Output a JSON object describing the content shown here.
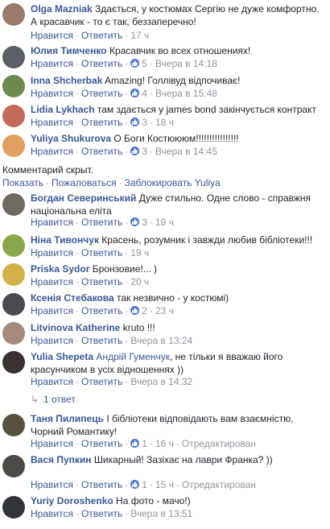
{
  "labels": {
    "like": "Нравится",
    "reply": "Ответить",
    "dot": "·",
    "edited": "Отредактирован"
  },
  "comments": [
    {
      "author": "Olga Mazniak",
      "text": "Здається, у костюмах Сергію не дуже комфортно. А красавчик - то є так, беззаперечно!",
      "likes": "",
      "time": "17 ч",
      "avatar_color": "#9a7b6a"
    },
    {
      "author": "Юлия Тимченко",
      "text": "Красавчик во всех отношениях!",
      "likes": "5",
      "time": "Вчера в 14:18",
      "avatar_color": "#5b5f66"
    },
    {
      "author": "Inna Shcherbak",
      "text": "Amazing! Голлівуд відпочиває!",
      "likes": "4",
      "time": "Вчера в 15:48",
      "avatar_color": "#6b8a4e"
    },
    {
      "author": "Lidia Lykhach",
      "text": "там здається у james bond закінчується контракт",
      "likes": "3",
      "time": "18 ч",
      "avatar_color": "#c46a5a"
    },
    {
      "author": "Yuliya Shukurova",
      "text": "О Боги Костюююм!!!!!!!!!!!!!!!!",
      "likes": "3",
      "time": "Вчера в 14:45",
      "avatar_color": "#e0a060"
    },
    {
      "author": "Богдан Северинський",
      "text": "Дуже стильно. Одне слово - справжня національна еліта",
      "likes": "3",
      "time": "19 ч",
      "avatar_color": "#6e6a60"
    },
    {
      "author": "Ніна Тивончук",
      "text": "Красень, розумник і завжди любив бібліотеки!!!",
      "likes": "",
      "time": "19 ч",
      "avatar_color": "#8aa64a"
    },
    {
      "author": "Priska Sydor",
      "text": "Бронзовие!... )",
      "likes": "",
      "time": "20 ч",
      "avatar_color": "#d4b048"
    },
    {
      "author": "Ксенія Стебакова",
      "text": "так незвично - у костюмі)",
      "likes": "2",
      "time": "23 ч",
      "avatar_color": "#4a4a50"
    },
    {
      "author": "Litvinova Katherine",
      "text": "kruto !!!",
      "likes": "",
      "time": "Вчера в 13:24",
      "avatar_color": "#a58a7a"
    },
    {
      "author": "Yulia Shepeta",
      "mention": "Андрій Гуменчук",
      "text": ", не тільки я вважаю його красунчиком в усіх відношеннях ))",
      "likes": "",
      "time": "Вчера в 14:32",
      "avatar_color": "#3a3030"
    },
    {
      "author": "Таня Пилипець",
      "text": "І бібліотеки відповідають вам взаємністю, Чорний Романтику!",
      "likes": "1",
      "time": "16 ч",
      "edited": true,
      "avatar_color": "#5a5040"
    },
    {
      "author": "Вася Пупкин",
      "text": "Шикарный! Зазіхає на лаври Франка? ))",
      "likes": "1",
      "time": "15 ч",
      "edited": true,
      "avatar_color": "#4b4b48"
    },
    {
      "author": "Yuriy Doroshenko",
      "text": "На фото - мачо!)",
      "likes": "",
      "time": "Вчера в 13:51",
      "avatar_color": "#30353a"
    }
  ],
  "hidden_comment": {
    "title": "Комментарий скрыт.",
    "show": "Показать",
    "unhide": "Пожаловаться",
    "block": "Заблокировать Yuliya",
    "sep": "·"
  },
  "replies": {
    "arrow": "↳",
    "label": "1 ответ"
  }
}
